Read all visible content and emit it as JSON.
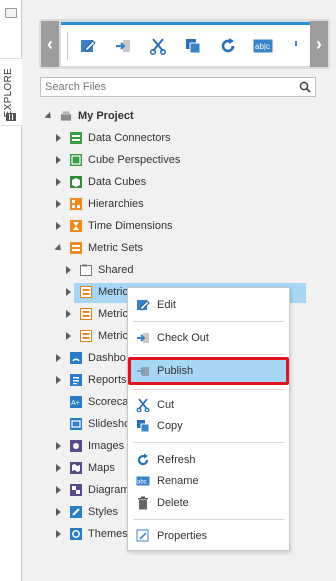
{
  "rail": {
    "explore_label": "EXPLORE"
  },
  "toolbar": {
    "prev": "‹",
    "next": "›",
    "tools": [
      "edit-icon",
      "move-icon",
      "cut-icon",
      "copy-icon",
      "refresh-icon",
      "rename-icon",
      "more-icon"
    ]
  },
  "search": {
    "placeholder": "Search Files",
    "value": ""
  },
  "tree": {
    "root": "My Project",
    "items": {
      "data_connectors": "Data Connectors",
      "cube_perspectives": "Cube Perspectives",
      "data_cubes": "Data Cubes",
      "hierarchies": "Hierarchies",
      "time_dimensions": "Time Dimensions",
      "metric_sets": "Metric Sets",
      "shared": "Shared",
      "metric1": "Metric",
      "metric2": "Metric",
      "metric3": "Metric",
      "dashboards": "Dashbo",
      "reports": "Reports",
      "scorecards": "Scorecar",
      "slideshows": "Slidesho",
      "images": "Images",
      "maps": "Maps",
      "diagrams": "Diagram",
      "styles": "Styles",
      "themes": "Themes"
    }
  },
  "context_menu": {
    "edit": "Edit",
    "check_out": "Check Out",
    "publish": "Publish",
    "cut": "Cut",
    "copy": "Copy",
    "refresh": "Refresh",
    "rename": "Rename",
    "delete": "Delete",
    "properties": "Properties"
  },
  "colors": {
    "accent": "#2a8fd0",
    "selection": "#a8d6f5",
    "highlight_border": "#e0141f"
  }
}
